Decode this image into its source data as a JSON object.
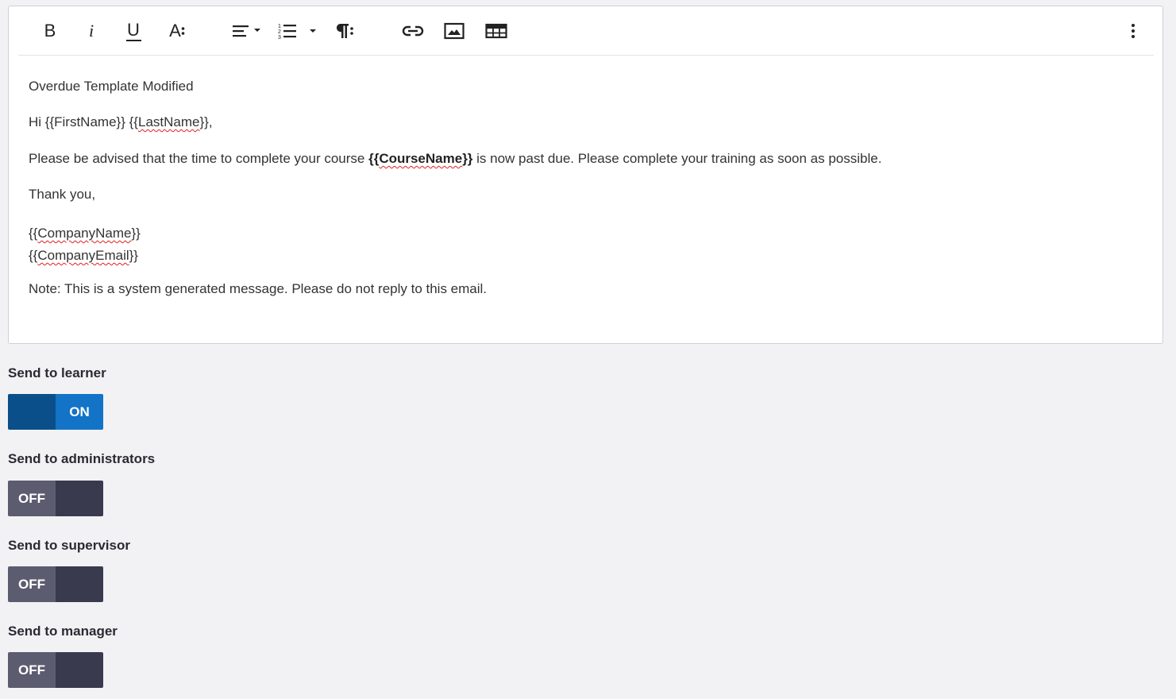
{
  "toolbar": {
    "buttons": [
      {
        "name": "bold",
        "glyph": "B"
      },
      {
        "name": "italic",
        "glyph": "i"
      },
      {
        "name": "underline",
        "glyph": "U"
      },
      {
        "name": "font-size",
        "glyph": "A"
      }
    ]
  },
  "editor": {
    "title": "Overdue Template Modified",
    "greeting_prefix": "Hi ",
    "first_name_var": "{{FirstName}}",
    "greeting_space": " {{",
    "last_name_word": "LastName",
    "greeting_suffix": "}},",
    "body_prefix": "Please be advised that the time to complete your course ",
    "body_var_open": "{{",
    "body_var_word": "CourseName",
    "body_var_close": "}}",
    "body_suffix": " is now past due. Please complete your training as soon as possible.",
    "thanks": "Thank you,",
    "sign_open_1": "{{",
    "sign_word_1": "CompanyName",
    "sign_close_1": "}}",
    "sign_open_2": "{{",
    "sign_word_2": "CompanyEmail",
    "sign_close_2": "}}",
    "note": "Note: This is a system generated message. Please do not reply to this email."
  },
  "settings": [
    {
      "label": "Send to learner",
      "state": "ON"
    },
    {
      "label": "Send to administrators",
      "state": "OFF"
    },
    {
      "label": "Send to supervisor",
      "state": "OFF"
    },
    {
      "label": "Send to manager",
      "state": "OFF"
    }
  ],
  "colors": {
    "toggle_on_dark": "#0b4f8a",
    "toggle_on_light": "#1273c7",
    "toggle_off_light": "#5c5c70",
    "toggle_off_dark": "#3a3a4e",
    "spellcheck": "#e02020"
  }
}
